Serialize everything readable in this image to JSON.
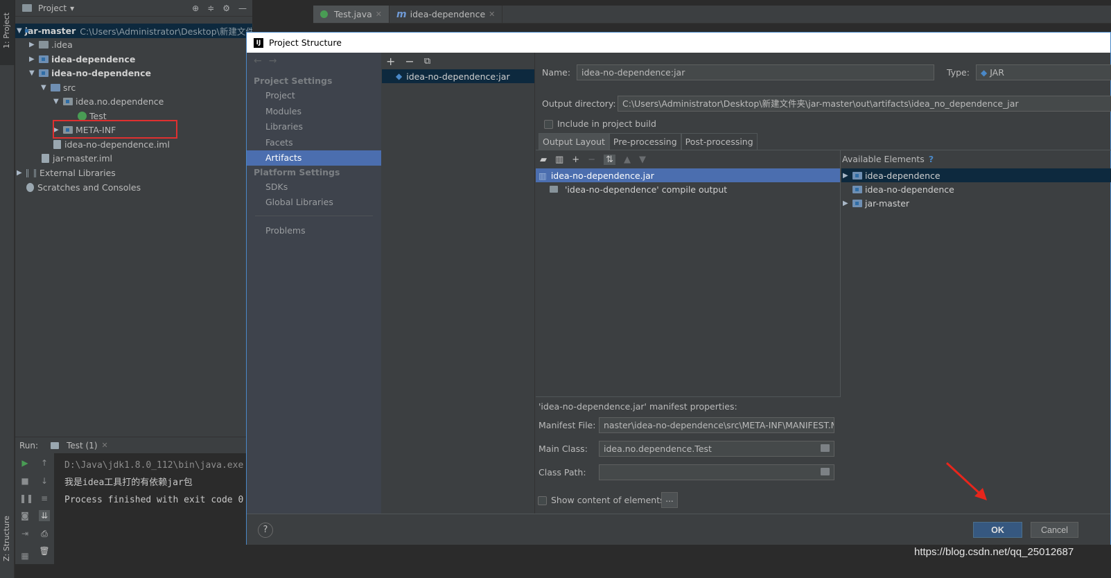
{
  "sidebar": {
    "project_tab": "1: Project",
    "structure_tab": "Z: Structure"
  },
  "project_panel": {
    "title": "Project",
    "tree": [
      {
        "label": "jar-master",
        "path": "C:\\Users\\Administrator\\Desktop\\新建文件夹\\jar-master"
      },
      {
        "label": ".idea"
      },
      {
        "label": "idea-dependence"
      },
      {
        "label": "idea-no-dependence"
      },
      {
        "label": "src"
      },
      {
        "label": "idea.no.dependence"
      },
      {
        "label": "Test"
      },
      {
        "label": "META-INF"
      },
      {
        "label": "idea-no-dependence.iml"
      },
      {
        "label": "jar-master.iml"
      },
      {
        "label": "External Libraries"
      },
      {
        "label": "Scratches and Consoles"
      }
    ]
  },
  "editor_tabs": [
    {
      "label": "Test.java"
    },
    {
      "label": "idea-dependence"
    }
  ],
  "run_panel": {
    "run_label": "Run:",
    "tab_label": "Test (1)",
    "console": {
      "cmd": "D:\\Java\\jdk1.8.0_112\\bin\\java.exe",
      "output": "我是idea工具打的有依赖jar包",
      "finished": "Process finished with exit code 0"
    }
  },
  "dialog": {
    "title": "Project Structure",
    "nav": {
      "project_settings": "Project Settings",
      "items_ps": [
        "Project",
        "Modules",
        "Libraries",
        "Facets",
        "Artifacts"
      ],
      "platform_settings": "Platform Settings",
      "items_plat": [
        "SDKs",
        "Global Libraries"
      ],
      "problems": "Problems"
    },
    "artifact_name": "idea-no-dependence:jar",
    "config": {
      "name_label": "Name:",
      "name_value": "idea-no-dependence:jar",
      "type_label": "Type:",
      "type_value": "JAR",
      "output_dir_label": "Output directory:",
      "output_dir_value": "C:\\Users\\Administrator\\Desktop\\新建文件夹\\jar-master\\out\\artifacts\\idea_no_dependence_jar",
      "include_build": "Include in project build",
      "tabs": [
        "Output Layout",
        "Pre-processing",
        "Post-processing"
      ],
      "layout_items": [
        "idea-no-dependence.jar",
        "'idea-no-dependence' compile output"
      ],
      "available_title": "Available Elements",
      "available_help": "?",
      "available_items": [
        "idea-dependence",
        "idea-no-dependence",
        "jar-master"
      ],
      "manifest_title": "'idea-no-dependence.jar' manifest properties:",
      "manifest_file_label": "Manifest File:",
      "manifest_file_value": "naster\\idea-no-dependence\\src\\META-INF\\MANIFEST.MF",
      "main_class_label": "Main Class:",
      "main_class_value": "idea.no.dependence.Test",
      "class_path_label": "Class Path:",
      "class_path_value": "",
      "show_content": "Show content of elements",
      "dots": "..."
    },
    "help": "?",
    "ok": "OK",
    "cancel": "Cancel"
  },
  "watermark": "https://blog.csdn.net/qq_25012687",
  "colors": {
    "accent": "#4b6eaf",
    "selection": "#0d293e",
    "highlight_box": "#e03030",
    "ok_button": "#365880"
  }
}
